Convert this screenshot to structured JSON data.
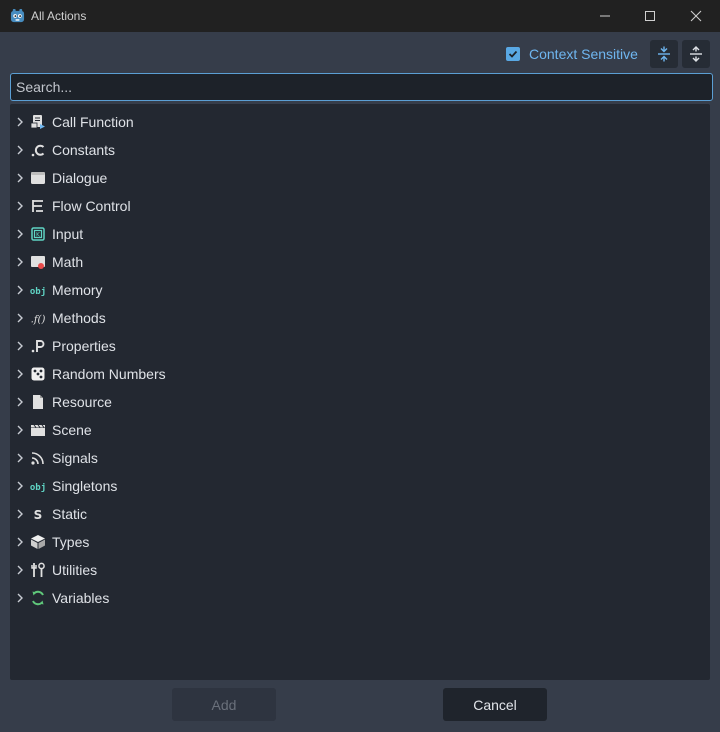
{
  "window": {
    "title": "All Actions",
    "app_icon": "godot-icon",
    "controls": [
      "minimize-icon",
      "maximize-icon",
      "close-icon"
    ]
  },
  "toolbar": {
    "context_sensitive_label": "Context Sensitive",
    "context_sensitive_checked": true,
    "collapse_icon": "collapse-all-icon",
    "expand_icon": "expand-all-icon"
  },
  "search": {
    "placeholder": "Search...",
    "value": ""
  },
  "tree": {
    "items": [
      {
        "label": "Call Function",
        "icon": "call-function-icon"
      },
      {
        "label": "Constants",
        "icon": "constants-icon"
      },
      {
        "label": "Dialogue",
        "icon": "dialogue-icon"
      },
      {
        "label": "Flow Control",
        "icon": "flow-control-icon"
      },
      {
        "label": "Input",
        "icon": "input-icon"
      },
      {
        "label": "Math",
        "icon": "math-icon"
      },
      {
        "label": "Memory",
        "icon": "memory-icon"
      },
      {
        "label": "Methods",
        "icon": "methods-icon"
      },
      {
        "label": "Properties",
        "icon": "properties-icon"
      },
      {
        "label": "Random Numbers",
        "icon": "dice-icon"
      },
      {
        "label": "Resource",
        "icon": "resource-icon"
      },
      {
        "label": "Scene",
        "icon": "scene-icon"
      },
      {
        "label": "Signals",
        "icon": "signals-icon"
      },
      {
        "label": "Singletons",
        "icon": "singletons-icon"
      },
      {
        "label": "Static",
        "icon": "static-icon"
      },
      {
        "label": "Types",
        "icon": "types-icon"
      },
      {
        "label": "Utilities",
        "icon": "utilities-icon"
      },
      {
        "label": "Variables",
        "icon": "variables-icon"
      }
    ]
  },
  "buttons": {
    "add_label": "Add",
    "add_enabled": false,
    "cancel_label": "Cancel"
  },
  "colors": {
    "accent": "#59a8e4",
    "panel": "#232831",
    "background": "#363d4a",
    "obj_teal": "#5fd4c4"
  }
}
